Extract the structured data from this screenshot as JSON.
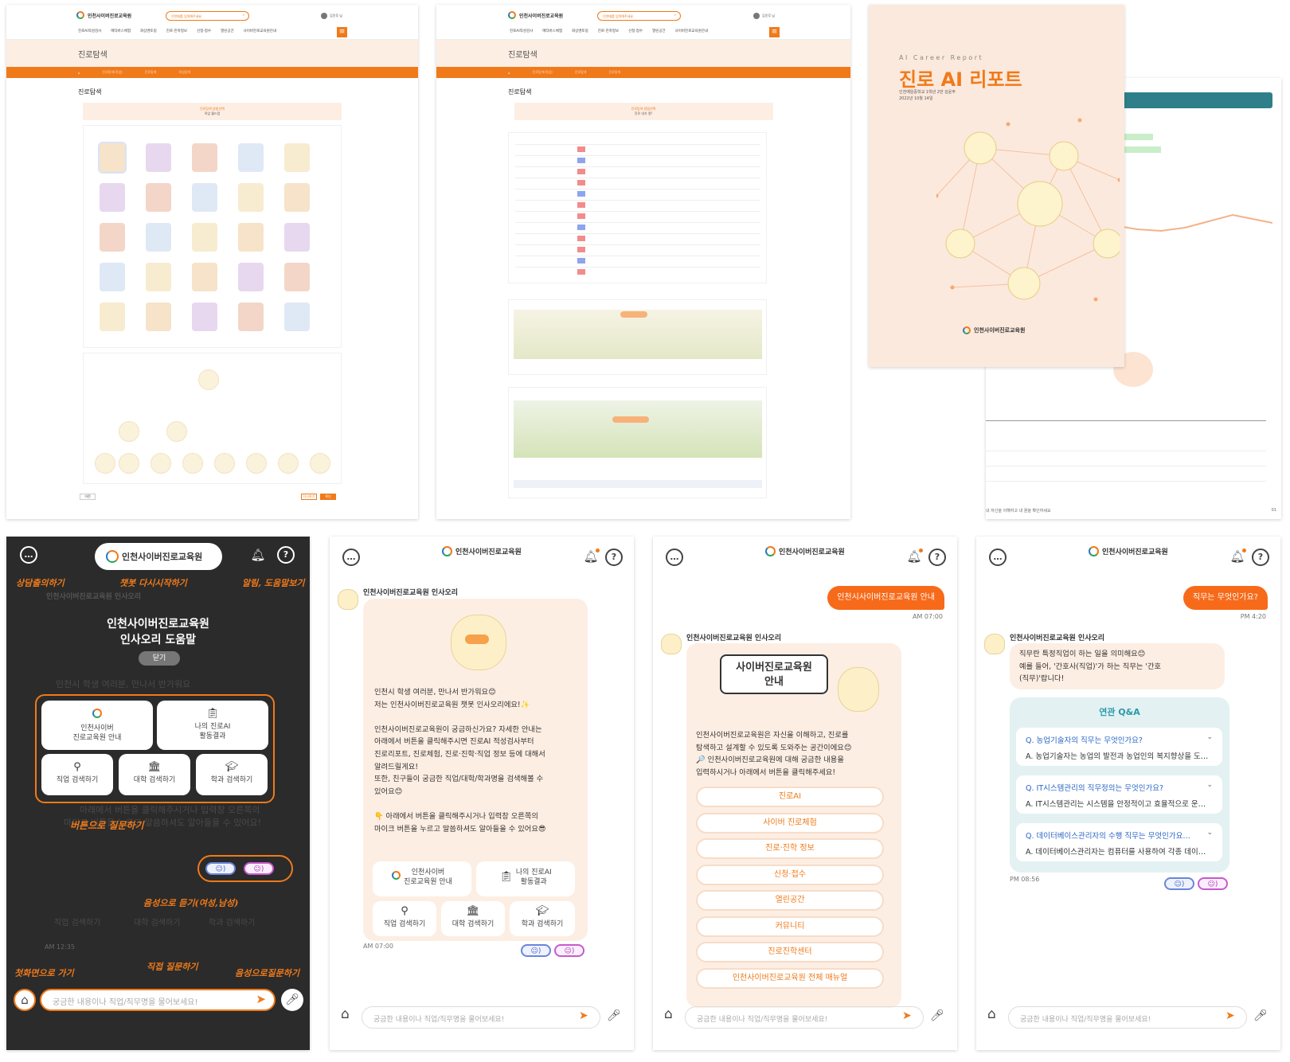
{
  "web1": {
    "logo": "인천사이버진로교육원",
    "search_placeholder": "인천매를 입력해주세요",
    "user": "김윤루 님",
    "nav": [
      "진로AI적성검사",
      "메타버스체험",
      "화상멘토링",
      "진로·진학정보",
      "신청·접수",
      "열린공간",
      "사이버진로교육원안내"
    ],
    "menu_icon": "hamburger-icon",
    "sub_title": "진로탐색",
    "breadcrumb": [
      "진로탐색(직업)",
      "진로탐색",
      "직업탐색"
    ],
    "page_title": "진로탐색",
    "pink_line1": "진로탐색 방법선택",
    "pink_line2": "직업 월드컵",
    "btn_prev": "이전",
    "btn_a": "다시하기",
    "btn_b": "확인"
  },
  "web2": {
    "logo": "인천사이버진로교육원",
    "search_placeholder": "인천매를 입력해주세요",
    "user": "김윤루 님",
    "nav": [
      "진로AI적성검사",
      "메타버스체험",
      "화상멘토링",
      "진로·진학정보",
      "신청·접수",
      "열린공간",
      "사이버진로교육원안내"
    ],
    "sub_title": "진로탐색",
    "breadcrumb": [
      "진로탐색(직업)",
      "진로탐색",
      "진로탐색"
    ],
    "page_title": "진로탐색",
    "pink_line1": "진로탐색 방법선택",
    "pink_line2": "진로 내가 짱!"
  },
  "report": {
    "subtitle": "AI Career Report",
    "title": "진로 AI 리포트",
    "meta1": "인천예일중학교 1학년 2반 김윤주",
    "meta2": "2022년 10월 14일",
    "logo": "인천사이버진로교육원",
    "footer_note": "내 자신을 이해하고 내 꿈을 확인하세요",
    "page_no": "01"
  },
  "help": {
    "logo": "인천사이버진로교육원",
    "title_line1": "인천사이버진로교육원",
    "title_line2": "인사오리 도움말",
    "close": "닫기",
    "ann_chat": "상담출의하기",
    "ann_restart": "챗봇 다시시작하기",
    "ann_alarm": "알림, 도움말보기",
    "ann_button": "버튼으로 질문하기",
    "ann_voice": "음성으로 듣기(여성,남성)",
    "ann_home": "첫화면으로 가기",
    "ann_direct": "직접 질문하기",
    "ann_mic": "음성으로질문하기",
    "bot_name": "인천사이버진로교육원 인사오리",
    "dim_greeting": "인천시 학생 여러분, 만나서 반가워요",
    "dim_text1": "아래에서 버튼을 클릭해주시거나 입력창 오른쪽의",
    "dim_text2": "마이크 버튼을 누르고 말씀하셔도 알아들을 수 있어요!",
    "buttons": [
      "인천사이버\n진로교육원 안내",
      "나의 진로AI\n활동결과",
      "직업 검색하기",
      "대학 검색하기",
      "학과 검색하기"
    ],
    "time": "AM 12:35",
    "input_placeholder": "궁금한 내용이나 직업/직무명을 물어보세요!"
  },
  "chat1": {
    "logo": "인천사이버진로교육원",
    "bot_name": "인천사이버진로교육원 인사오리",
    "message": "인천시 학생 여러분, 만나서 반가워요😊\n저는 인천사이버진로교육원 챗봇 인사오리에요!✨\n\n인천사이버진로교육원이 궁금하신가요? 자세한 안내는\n아래에서 버튼을 클릭해주시면 진로AI 적성검사부터\n진로리포트, 진로체험, 진로·진학·직업 정보 등에 대해서\n알려드릴게요!\n또한, 친구들이 궁금한 직업/대학/학과명을 검색해볼 수\n있어요😊\n\n👇 아래에서 버튼을 클릭해주시거나 입력창 오른쪽의\n마이크 버튼을 누르고 말씀하셔도 알아들을 수 있어요😎",
    "buttons": [
      "인천사이버\n진로교육원 안내",
      "나의 진로AI\n활동결과",
      "직업 검색하기",
      "대학 검색하기",
      "학과 검색하기"
    ],
    "time": "AM 07:00",
    "input_placeholder": "궁금한 내용이나 직업/직무명을 물어보세요!"
  },
  "chat2": {
    "logo": "인천사이버진로교육원",
    "user_msg": "인천시사이버진로교육원 안내",
    "user_time": "AM 07:00",
    "bot_name": "인천사이버진로교육원 인사오리",
    "card_title": "사이버진로교육원\n안내",
    "message": "인천사이버진로교육원은 자신을 이해하고, 진로를\n탐색하고 설계할 수 있도록 도와주는 공간이에요😊\n🔎 인천사이버진로교육원에 대해 궁금한 내용을\n입력하시거나 아래에서 버튼을 클릭해주세요!",
    "menu": [
      "진로AI",
      "사이버 진로체험",
      "진로·진학 정보",
      "신청·접수",
      "열린공간",
      "커뮤니티",
      "진로진학센터",
      "인천사이버진로교육원 전체 매뉴얼"
    ],
    "input_placeholder": "궁금한 내용이나 직업/직무명을 물어보세요!"
  },
  "chat3": {
    "logo": "인천사이버진로교육원",
    "user_msg": "직무는 무엇인가요?",
    "user_time": "PM 4:20",
    "bot_name": "인천사이버진로교육원 인사오리",
    "message": "직무란 특정직업이 하는 일을 의미해요😊\n예를 들어, '간호사(직업)'가 하는 직무는 '간호\n(직무)'랍니다!",
    "related_title": "연관 Q&A",
    "qa": [
      {
        "q": "Q. 농업기술자의 직무는 무엇인가요?",
        "a": "A. 농업기술자는 농업의 발전과 농업인의 복지향상을 도…"
      },
      {
        "q": "Q. IT시스템관리의 직무정의는 무엇인가요?",
        "a": "A. IT시스템관리는 시스템을 안정적이고 효율적으로 운…"
      },
      {
        "q": "Q. 데이터베이스관리자의 수행 직무는 무엇인가요…",
        "a": "A. 데이터베이스관리자는 컴퓨터를 사용하여 각종 데이…"
      }
    ],
    "time": "PM 08:56",
    "input_placeholder": "궁금한 내용이나 직업/직무명을 물어보세요!"
  },
  "colors": {
    "accent": "#f07a1a",
    "peach": "#fdeee3",
    "dark": "#2b2b2b",
    "qa_bg": "#e3f1f3"
  }
}
